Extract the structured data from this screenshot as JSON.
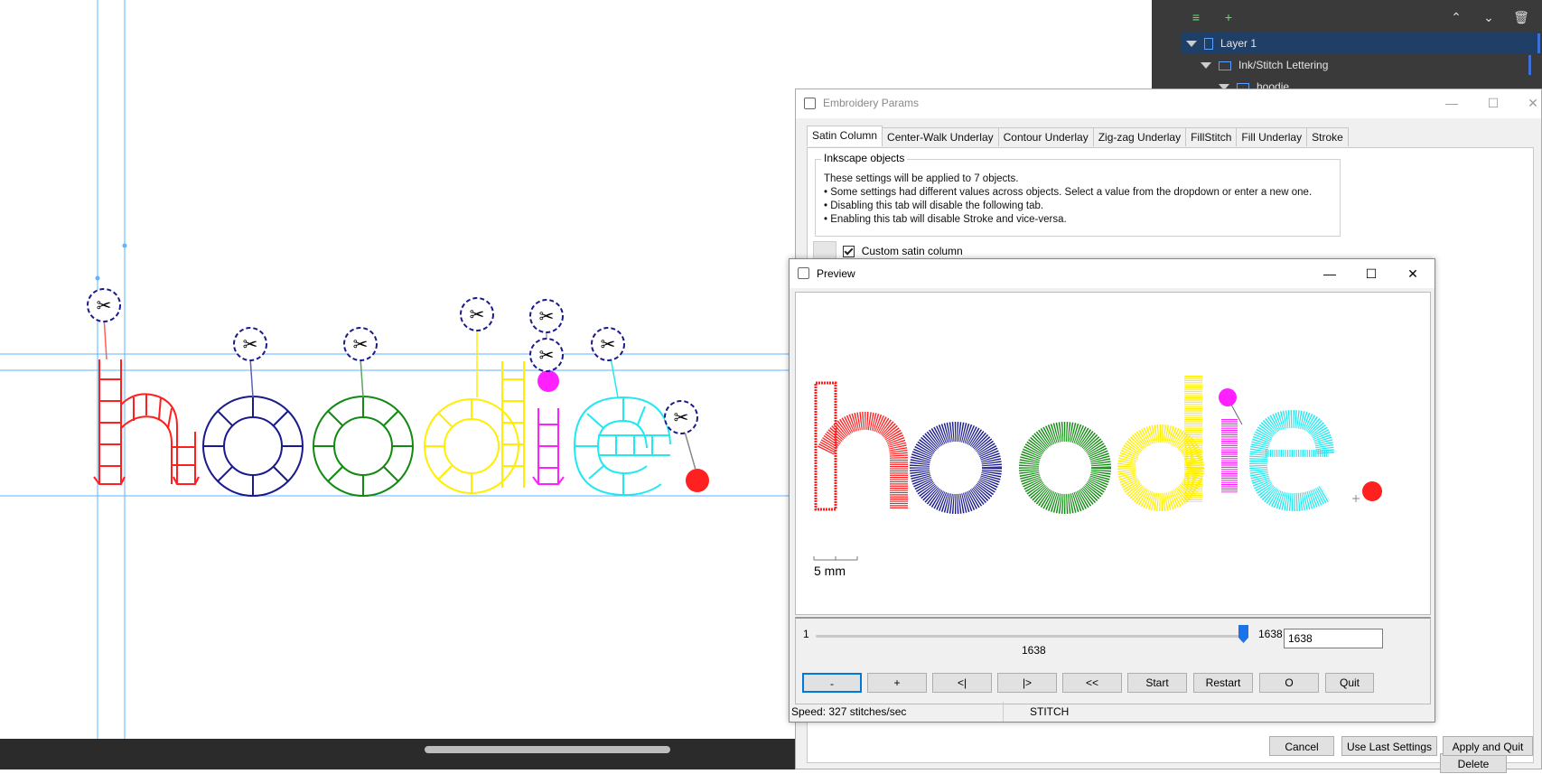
{
  "layers": {
    "rows": [
      {
        "label": "Layer 1"
      },
      {
        "label": "Ink/Stitch Lettering"
      },
      {
        "label": "hoodie."
      }
    ],
    "icons": {
      "add_layer": "add-layer-icon",
      "add_sublayer": "add-sublayer-icon",
      "up": "chevron-up-icon",
      "down": "chevron-down-icon",
      "delete": "trash-icon"
    }
  },
  "params": {
    "title": "Embroidery Params",
    "tabs": [
      "Satin Column",
      "Center-Walk Underlay",
      "Contour Underlay",
      "Zig-zag Underlay",
      "FillStitch",
      "Fill Underlay",
      "Stroke"
    ],
    "active_tab": "Satin Column",
    "group_title": "Inkscape objects",
    "info_lines": [
      "These settings will be applied to 7 objects.",
      "• Some settings had different values across objects.  Select a value from the dropdown or enter a new one.",
      "• Disabling this tab will disable the following tab.",
      "• Enabling this tab will disable Stroke and vice-versa."
    ],
    "custom_satin_label": "Custom satin column",
    "custom_satin_checked": true,
    "delete_label": "Delete",
    "cancel_label": "Cancel",
    "use_last_label": "Use Last Settings",
    "apply_label": "Apply and Quit"
  },
  "preview": {
    "title": "Preview",
    "word": "hoodie.",
    "scale_label": "5 mm",
    "slider_min": "1",
    "slider_max": "1638",
    "slider_value_label": "1638",
    "step_value": "1638",
    "buttons": [
      "-",
      "+",
      "<|",
      "|>",
      "<<",
      "Start",
      "Restart",
      "O",
      "Quit"
    ],
    "speed_text": "Speed: 327 stitches/sec",
    "mode_text": "STITCH",
    "colors": [
      "#ff1f1f",
      "#1a1a8c",
      "#128a12",
      "#ffee00",
      "#ff20ff",
      "#22e8f0",
      "#ff2020"
    ]
  },
  "canvas": {
    "letters": [
      "h",
      "o",
      "o",
      "d",
      "i",
      "e",
      "."
    ],
    "colors": [
      "#ff1f1f",
      "#1a1a8c",
      "#128a12",
      "#ffee00",
      "#ff20ff",
      "#22e8f0",
      "#ff2020"
    ],
    "trim_icon": "scissors-icon"
  }
}
